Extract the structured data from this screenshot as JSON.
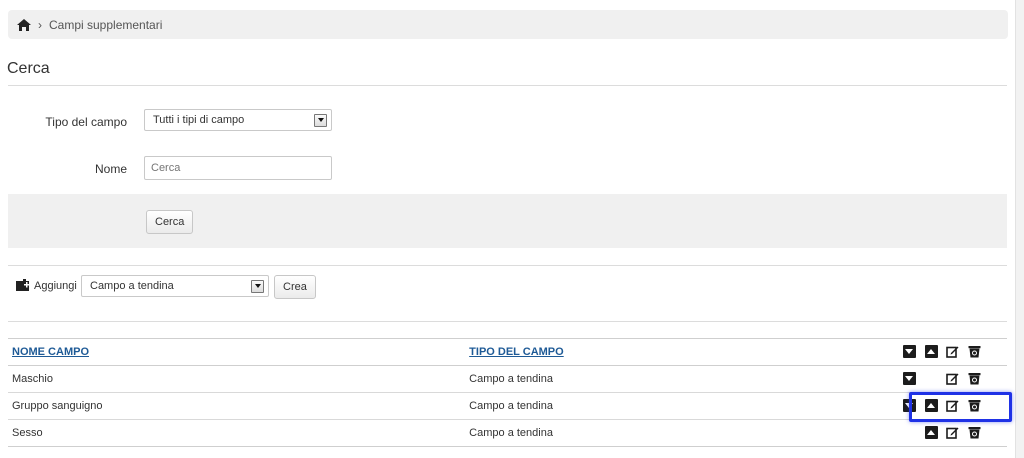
{
  "breadcrumb": {
    "home_icon": "home-icon",
    "separator": "›",
    "current": "Campi supplementari"
  },
  "search": {
    "title": "Cerca",
    "field_type_label": "Tipo del campo",
    "field_type_value": "Tutti i tipi di campo",
    "name_label": "Nome",
    "name_placeholder": "Cerca",
    "submit_label": "Cerca"
  },
  "add": {
    "icon": "add-field-icon",
    "label": "Aggiungi",
    "select_value": "Campo a tendina",
    "create_label": "Crea"
  },
  "table": {
    "columns": [
      "NOME CAMPO",
      "TIPO DEL CAMPO"
    ],
    "rows": [
      {
        "name": "Maschio",
        "type": "Campo a tendina"
      },
      {
        "name": "Gruppo sanguigno",
        "type": "Campo a tendina"
      },
      {
        "name": "Sesso",
        "type": "Campo a tendina"
      }
    ]
  },
  "colors": {
    "link": "#1e5a96",
    "highlight": "#1f32e6",
    "band": "#f0f0f0"
  }
}
